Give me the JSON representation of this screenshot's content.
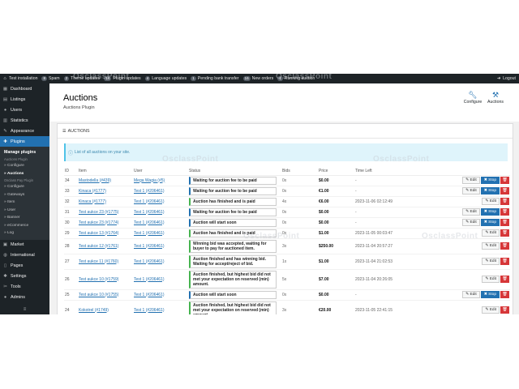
{
  "topbar": {
    "site": "Test installation",
    "items": [
      {
        "count": "8",
        "label": "Spam"
      },
      {
        "count": "2",
        "label": "Theme updates"
      },
      {
        "count": "14",
        "label": "Plugin updates"
      },
      {
        "count": "4",
        "label": "Language updates"
      },
      {
        "count": "1",
        "label": "Pending bank transfer"
      },
      {
        "count": "16",
        "label": "New orders"
      },
      {
        "count": "1",
        "label": "Running auction"
      }
    ],
    "logout": "Logout"
  },
  "sidebar": {
    "items_top": [
      {
        "label": "Dashboard",
        "icon": "dashboard-icon",
        "glyph": "▦"
      },
      {
        "label": "Listings",
        "icon": "listings-icon",
        "glyph": "▤"
      },
      {
        "label": "Users",
        "icon": "users-icon",
        "glyph": "●"
      },
      {
        "label": "Statistics",
        "icon": "statistics-icon",
        "glyph": "▥"
      },
      {
        "label": "Appearance",
        "icon": "appearance-icon",
        "glyph": "✎"
      },
      {
        "label": "Plugins",
        "icon": "plugins-icon",
        "glyph": "✚"
      }
    ],
    "sub": {
      "head": "Manage plugins",
      "group1": "Auctions Plugin",
      "links1": [
        "» Configure",
        "» Auctions"
      ],
      "group2": "Osclass Pay Plugin",
      "links2": [
        "» Configure",
        "» Gateways",
        "» Item",
        "» User",
        "» Banner",
        "» eCommerce",
        "» Log"
      ]
    },
    "items_bottom": [
      {
        "label": "Market",
        "icon": "market-icon",
        "glyph": "▣"
      },
      {
        "label": "International",
        "icon": "globe-icon",
        "glyph": "◍"
      },
      {
        "label": "Pages",
        "icon": "pages-icon",
        "glyph": "▯"
      },
      {
        "label": "Settings",
        "icon": "settings-icon",
        "glyph": "✱"
      },
      {
        "label": "Tools",
        "icon": "tools-icon",
        "glyph": "✂"
      },
      {
        "label": "Admins",
        "icon": "admins-icon",
        "glyph": "●"
      }
    ],
    "collapse": "≡"
  },
  "header": {
    "title": "Auctions",
    "subtitle": "Auctions Plugin",
    "configure": "Configure",
    "auctions": "Auctions"
  },
  "card": {
    "title": "AUCTIONS",
    "notice": "List of all auctions on your site."
  },
  "table": {
    "headers": {
      "id": "ID",
      "item": "Item",
      "user": "User",
      "status": "Status",
      "bids": "Bids",
      "price": "Price",
      "time": "Time Left"
    },
    "edit": "Edit",
    "stop": "Stop",
    "rows": [
      {
        "id": "34",
        "item": "Mastodella (#439)",
        "user": "Mega Wagia (#5)",
        "status": "Waiting for auction fee to be paid",
        "color": "blue",
        "bids": "0x",
        "price": "$0.00",
        "time": "-",
        "stop": true
      },
      {
        "id": "33",
        "item": "Kinaca (#1777)",
        "user": "Test 1 (#206461)",
        "status": "Waiting for auction fee to be paid",
        "color": "blue",
        "bids": "0x",
        "price": "€1.00",
        "time": "-",
        "stop": true
      },
      {
        "id": "32",
        "item": "Kinaca (#1777)",
        "user": "Test 1 (#206461)",
        "status": "Auction has finished and is paid",
        "color": "green",
        "bids": "4x",
        "price": "€6.00",
        "time": "2023-11-06 02:12:49",
        "stop": false
      },
      {
        "id": "31",
        "item": "Test aukce 23 (#1775)",
        "user": "Test 1 (#206461)",
        "status": "Waiting for auction fee to be paid",
        "color": "blue",
        "bids": "0x",
        "price": "$0.00",
        "time": "-",
        "stop": true
      },
      {
        "id": "30",
        "item": "Test aukce 23 (#1774)",
        "user": "Test 1 (#206461)",
        "status": "Auction will start soon",
        "color": "blue",
        "bids": "0x",
        "price": "$0.00",
        "time": "-",
        "stop": true
      },
      {
        "id": "29",
        "item": "Test aukce 13 (#1764)",
        "user": "Test 1 (#206461)",
        "status": "Auction has finished and is paid",
        "color": "green",
        "bids": "0x",
        "price": "$1.00",
        "time": "2023-11-05 00:03:47",
        "stop": false
      },
      {
        "id": "28",
        "item": "Test aukce 12 (#1761)",
        "user": "Test 1 (#206461)",
        "status": "Winning bid was accepted, waiting for buyer to pay for auctioned item.",
        "color": "green",
        "bids": "3x",
        "price": "$250.00",
        "time": "2023-11-04 20:57:27",
        "stop": false
      },
      {
        "id": "27",
        "item": "Test aukce 11 (#1760)",
        "user": "Test 1 (#206461)",
        "status": "Auction finished and has winning bid. Waiting for accept/reject of bid.",
        "color": "green",
        "bids": "1x",
        "price": "$1.00",
        "time": "2023-11-04 21:02:53",
        "stop": false
      },
      {
        "id": "26",
        "item": "Test aukce 10 (#1759)",
        "user": "Test 1 (#206461)",
        "status": "Auction finished, but highest bid did not met your expectation on reserved (min) amount.",
        "color": "green",
        "bids": "5x",
        "price": "$7.00",
        "time": "2023-11-04 20:26:05",
        "stop": false
      },
      {
        "id": "25",
        "item": "Test aukce 10 (#1755)",
        "user": "Test 1 (#206461)",
        "status": "Auction will start soon",
        "color": "blue",
        "bids": "0x",
        "price": "$0.00",
        "time": "-",
        "stop": true
      },
      {
        "id": "24",
        "item": "Kokotrel (#1749)",
        "user": "Test 1 (#206461)",
        "status": "Auction finished, but highest bid did not met your expectation on reserved (min) amount.",
        "color": "green",
        "bids": "3x",
        "price": "€20.00",
        "time": "2023-11-05 22:41:15",
        "stop": false
      }
    ]
  },
  "watermark": "OsclassPoint"
}
